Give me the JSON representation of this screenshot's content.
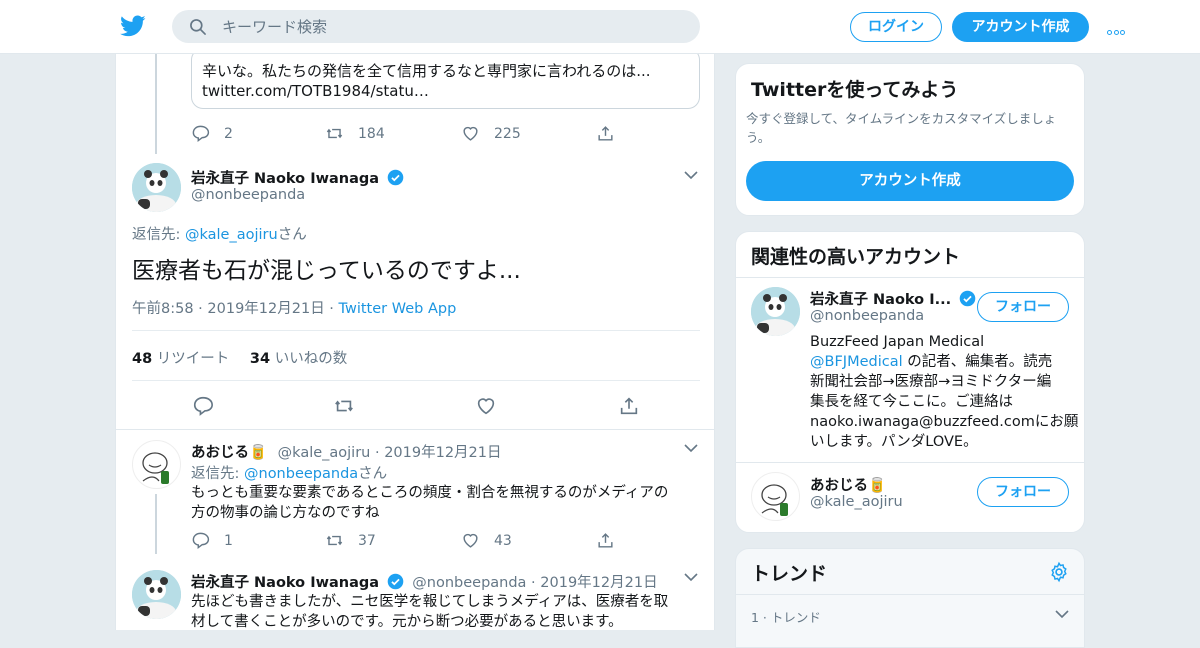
{
  "header": {
    "search_placeholder": "キーワード検索",
    "login": "ログイン",
    "signup": "アカウント作成"
  },
  "quote_tweet": {
    "text_line1": "辛いな。私たちの発信を全て信用するなと専門家に言われるのは...",
    "text_line2": "twitter.com/TOTB1984/statu…",
    "replies": "2",
    "retweets": "184",
    "likes": "225"
  },
  "main_tweet": {
    "name": "岩永直子 Naoko Iwanaga",
    "handle": "@nonbeepanda",
    "reply_prefix": "返信先: ",
    "reply_to": "@kale_aojiru",
    "reply_suffix": "さん",
    "text": "医療者も石が混じっているのですよ...",
    "time": "午前8:58 · 2019年12月21日 · ",
    "source": "Twitter Web App",
    "retweet_count": "48",
    "retweet_label": "リツイート",
    "like_count": "34",
    "like_label": "いいねの数"
  },
  "reply1": {
    "name": "あおじる🥫",
    "handle": "@kale_aojiru",
    "date": "· 2019年12月21日",
    "reply_prefix": "返信先: ",
    "reply_to": "@nonbeepanda",
    "reply_suffix": "さん",
    "text_line1": "もっとも重要な要素であるところの頻度・割合を無視するのがメディアの",
    "text_line2": "方の物事の論じ方なのですね",
    "replies": "1",
    "retweets": "37",
    "likes": "43"
  },
  "reply2": {
    "name": "岩永直子 Naoko Iwanaga",
    "handle": "@nonbeepanda",
    "date": "· 2019年12月21日",
    "text_line1": "先ほども書きましたが、ニセ医学を報じてしまうメディアは、医療者を取",
    "text_line2": "材して書くことが多いのです。元から断つ必要があると思います。"
  },
  "signup_card": {
    "title": "Twitterを使ってみよう",
    "desc_line1": "今すぐ登録して、タイムラインをカスタマイズしましょ",
    "desc_line2": "う。",
    "button": "アカウント作成"
  },
  "related": {
    "title": "関連性の高いアカウント",
    "accounts": [
      {
        "name": "岩永直子 Naoko I...",
        "handle": "@nonbeepanda",
        "follow": "フォロー",
        "bio_line1": "BuzzFeed Japan Medical",
        "bio_link": "@BFJMedical",
        "bio_line2": " の記者、編集者。読売",
        "bio_line3": "新聞社会部→医療部→ヨミドクター編",
        "bio_line4": "集長を経て今ここに。ご連絡は",
        "bio_line5": "naoko.iwanaga@buzzfeed.comにお願",
        "bio_line6": "いします。パンダLOVE。"
      },
      {
        "name": "あおじる🥫",
        "handle": "@kale_aojiru",
        "follow": "フォロー"
      }
    ]
  },
  "trends": {
    "title": "トレンド",
    "item1": "1 · トレンド"
  },
  "colors": {
    "accent": "#1da1f2",
    "link": "#1b95e0",
    "muted": "#657786",
    "background": "#e6ecf0"
  }
}
